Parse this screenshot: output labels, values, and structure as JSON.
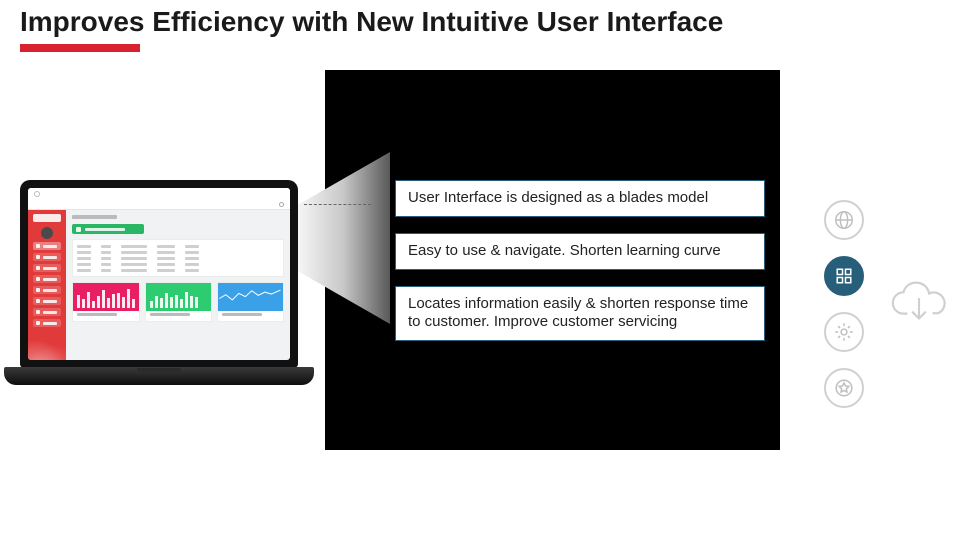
{
  "title": "Improves Efficiency with New Intuitive User Interface",
  "callouts": [
    "User Interface is designed as a blades model",
    "Easy to use & navigate. Shorten learning curve",
    "Locates information easily & shorten response time to customer.  Improve customer servicing"
  ],
  "icons": {
    "globe": "globe-icon",
    "grid": "grid-icon",
    "gear": "gear-icon",
    "star": "star-badge-icon",
    "cloud": "cloud-download-icon"
  },
  "screenshot": {
    "sidebar_items": 8,
    "charts": [
      "pink-bars",
      "green-bars",
      "blue-line"
    ]
  },
  "chart_data": [
    {
      "type": "bar",
      "name": "pink-bars",
      "values": [
        60,
        40,
        75,
        30,
        55,
        80,
        45,
        62,
        70,
        50,
        85,
        40
      ],
      "ylim": [
        0,
        100
      ]
    },
    {
      "type": "bar",
      "name": "green-bars",
      "values": [
        30,
        55,
        45,
        70,
        50,
        60,
        40,
        75,
        55,
        48
      ],
      "ylim": [
        0,
        100
      ]
    },
    {
      "type": "line",
      "name": "blue-line",
      "x": [
        0,
        1,
        2,
        3,
        4,
        5,
        6,
        7,
        8,
        9
      ],
      "values": [
        40,
        55,
        35,
        60,
        48,
        70,
        52,
        65,
        58,
        72
      ],
      "ylim": [
        0,
        100
      ]
    }
  ],
  "colors": {
    "accent_red": "#d92231",
    "panel_dark": "#000000",
    "callout_border": "#275e7a",
    "icon_solid": "#275e7a",
    "sidebar_red": "#e13a3a",
    "chart_pink": "#e91e63",
    "chart_green": "#2ecc71",
    "chart_blue": "#3aa0e8"
  }
}
